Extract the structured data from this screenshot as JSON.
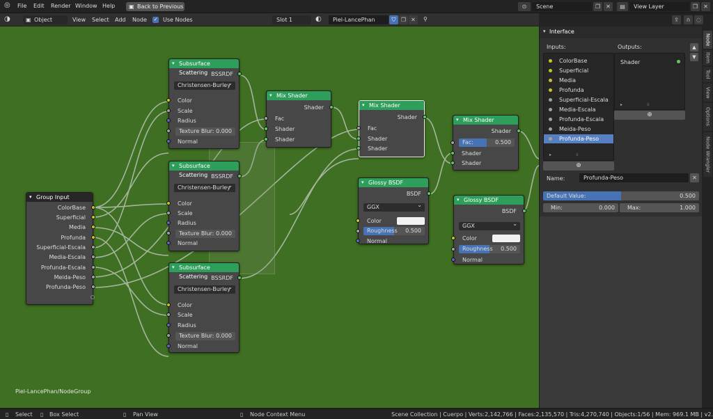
{
  "topbar": {
    "menus": [
      "File",
      "Edit",
      "Render",
      "Window",
      "Help"
    ],
    "back_button": "Back to Previous",
    "scene_field": "Scene",
    "view_layer_field": "View Layer"
  },
  "header": {
    "mode": "Object",
    "menus": [
      "View",
      "Select",
      "Add",
      "Node"
    ],
    "use_nodes_label": "Use Nodes",
    "slot": "Slot 1",
    "material": "Piel-LancePhan"
  },
  "nodes": {
    "sss1": {
      "title": "Subsurface Scattering",
      "out": "BSSRDF",
      "method": "Christensen-Burley",
      "inputs": [
        "Color",
        "Scale",
        "Radius"
      ],
      "blur_label": "Texture Blur:",
      "blur_value": "0.000",
      "normal": "Normal"
    },
    "sss2": {
      "title": "Subsurface Scattering",
      "out": "BSSRDF",
      "method": "Christensen-Burley",
      "inputs": [
        "Color",
        "Scale",
        "Radius"
      ],
      "blur_label": "Texture Blur:",
      "blur_value": "0.000",
      "normal": "Normal"
    },
    "sss3": {
      "title": "Subsurface Scattering",
      "out": "BSSRDF",
      "method": "Christensen-Burley",
      "inputs": [
        "Color",
        "Scale",
        "Radius"
      ],
      "blur_label": "Texture Blur:",
      "blur_value": "0.000",
      "normal": "Normal"
    },
    "group_input": {
      "title": "Group Input",
      "outputs": [
        "ColorBase",
        "Superficial",
        "Media",
        "Profunda",
        "Superficial-Escala",
        "Media-Escala",
        "Profunda-Escala",
        "Meida-Peso",
        "Profunda-Peso"
      ]
    },
    "mix1": {
      "title": "Mix Shader",
      "out": "Shader",
      "inputs": [
        "Fac",
        "Shader",
        "Shader"
      ]
    },
    "mix2": {
      "title": "Mix Shader",
      "out": "Shader",
      "inputs": [
        "Fac",
        "Shader",
        "Shader"
      ]
    },
    "mix3": {
      "title": "Mix Shader",
      "out": "Shader",
      "fac_label": "Fac:",
      "fac_value": "0.500",
      "fac_fill": 0.5,
      "inputs": [
        "Shader",
        "Shader"
      ]
    },
    "glossy1": {
      "title": "Glossy BSDF",
      "out": "BSDF",
      "dist": "GGX",
      "color": "Color",
      "rough_label": "Roughness",
      "rough_value": "0.500",
      "rough_fill": 0.5,
      "normal": "Normal"
    },
    "glossy2": {
      "title": "Glossy BSDF",
      "out": "BSDF",
      "dist": "GGX",
      "color": "Color",
      "rough_label": "Roughness",
      "rough_value": "0.500",
      "rough_fill": 0.5,
      "normal": "Normal"
    }
  },
  "canvas_label": "Piel-LancePhan/NodeGroup",
  "sidebar": {
    "panel_title": "Interface",
    "inputs_label": "Inputs:",
    "outputs_label": "Outputs:",
    "inputs": [
      "ColorBase",
      "Superficial",
      "Media",
      "Profunda",
      "Superficial-Escala",
      "Media-Escala",
      "Profunda-Escala",
      "Meida-Peso",
      "Profunda-Peso"
    ],
    "input_colors": [
      "#c7c729",
      "#c7c729",
      "#c7c729",
      "#c7c729",
      "#a1a1a1",
      "#a1a1a1",
      "#a1a1a1",
      "#a1a1a1",
      "#a1a1a1"
    ],
    "outputs": [
      "Shader"
    ],
    "name_label": "Name:",
    "name_value": "Profunda-Peso",
    "default_label": "Default Value:",
    "default_value": "0.500",
    "default_fill": 0.5,
    "min_label": "Min:",
    "min_value": "0.000",
    "max_label": "Max:",
    "max_value": "1.000",
    "tabs": [
      "Node",
      "Item",
      "Tool",
      "View",
      "Options",
      "Node Wrangler"
    ]
  },
  "status": {
    "select": "Select",
    "box_select": "Box Select",
    "pan_view": "Pan View",
    "context_menu": "Node Context Menu",
    "stats": "Scene Collection | Cuerpo | Verts:2,142,766 | Faces:2,135,570 | Tris:4,270,740 | Objects:1/56 | Mem: 969.1 MB | v2.80.75"
  },
  "colors": {
    "node_header": "#2e9e5b",
    "canvas": "#3f6f22",
    "active_item": "#5680c2"
  }
}
